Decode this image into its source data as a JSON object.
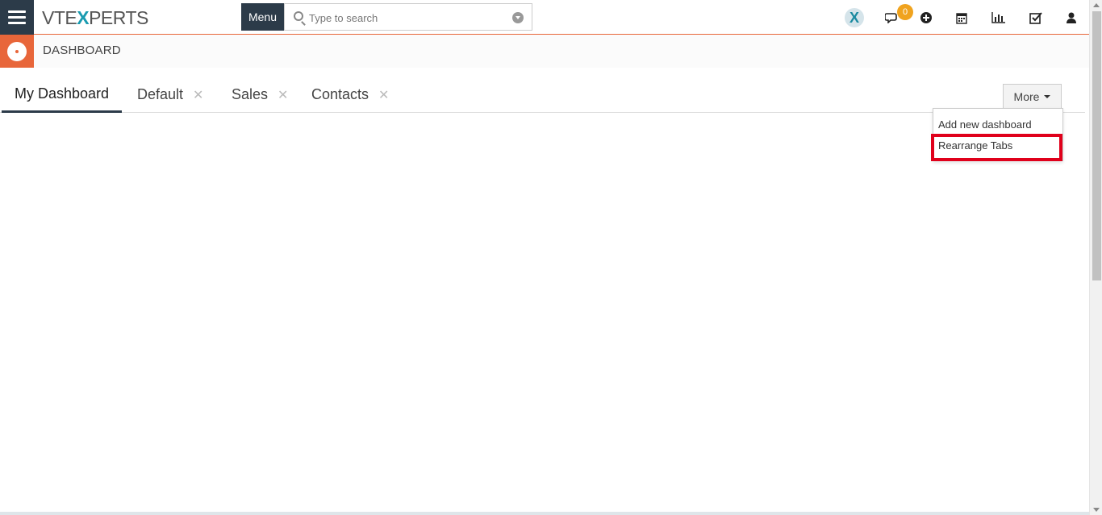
{
  "topbar": {
    "logo_part1": "VTE",
    "logo_x": "X",
    "logo_part2": "PERTS",
    "menu_label": "Menu",
    "search_placeholder": "Type to search",
    "notification_count": "0"
  },
  "module": {
    "title": "DASHBOARD"
  },
  "tabs": [
    {
      "label": "My Dashboard",
      "closable": false,
      "active": true
    },
    {
      "label": "Default",
      "closable": true,
      "active": false
    },
    {
      "label": "Sales",
      "closable": true,
      "active": false
    },
    {
      "label": "Contacts",
      "closable": true,
      "active": false
    }
  ],
  "more": {
    "label": "More",
    "items": [
      "Add new dashboard",
      "Rearrange Tabs"
    ]
  },
  "colors": {
    "navy": "#2c3b49",
    "accent": "#e8663a",
    "highlight": "#e0001b",
    "badge": "#f0a31e"
  }
}
